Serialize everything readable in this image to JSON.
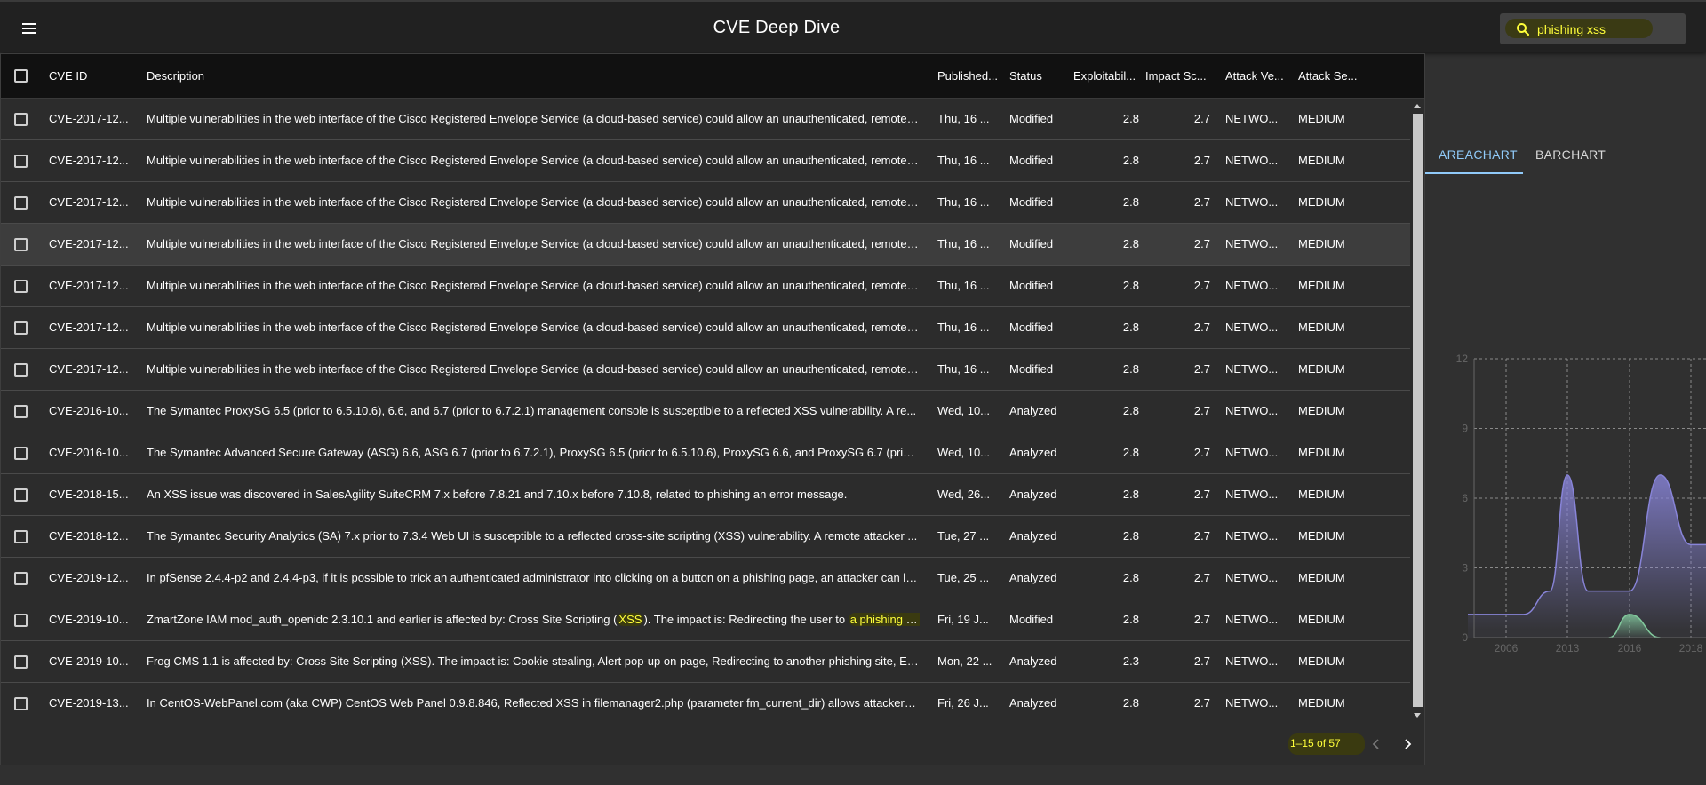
{
  "app": {
    "title": "CVE Deep Dive",
    "search_value": "phishing xss",
    "accent_color": "#90caf9",
    "highlight_color": "#ffff3a"
  },
  "table": {
    "columns": [
      "CVE ID",
      "Description",
      "Published...",
      "Status",
      "Exploitabil...",
      "Impact Sc...",
      "Attack Ve...",
      "Attack Se..."
    ],
    "rows": [
      {
        "id": "CVE-2017-12...",
        "desc": "Multiple vulnerabilities in the web interface of the Cisco Registered Envelope Service (a cloud-based service) could allow an unauthenticated, remote ...",
        "published": "Thu, 16 ...",
        "status": "Modified",
        "exploitability": "2.8",
        "impact": "2.7",
        "vector": "NETWO...",
        "severity": "MEDIUM"
      },
      {
        "id": "CVE-2017-12...",
        "desc": "Multiple vulnerabilities in the web interface of the Cisco Registered Envelope Service (a cloud-based service) could allow an unauthenticated, remote ...",
        "published": "Thu, 16 ...",
        "status": "Modified",
        "exploitability": "2.8",
        "impact": "2.7",
        "vector": "NETWO...",
        "severity": "MEDIUM"
      },
      {
        "id": "CVE-2017-12...",
        "desc": "Multiple vulnerabilities in the web interface of the Cisco Registered Envelope Service (a cloud-based service) could allow an unauthenticated, remote ...",
        "published": "Thu, 16 ...",
        "status": "Modified",
        "exploitability": "2.8",
        "impact": "2.7",
        "vector": "NETWO...",
        "severity": "MEDIUM"
      },
      {
        "id": "CVE-2017-12...",
        "desc": "Multiple vulnerabilities in the web interface of the Cisco Registered Envelope Service (a cloud-based service) could allow an unauthenticated, remote ...",
        "published": "Thu, 16 ...",
        "status": "Modified",
        "exploitability": "2.8",
        "impact": "2.7",
        "vector": "NETWO...",
        "severity": "MEDIUM"
      },
      {
        "id": "CVE-2017-12...",
        "desc": "Multiple vulnerabilities in the web interface of the Cisco Registered Envelope Service (a cloud-based service) could allow an unauthenticated, remote ...",
        "published": "Thu, 16 ...",
        "status": "Modified",
        "exploitability": "2.8",
        "impact": "2.7",
        "vector": "NETWO...",
        "severity": "MEDIUM"
      },
      {
        "id": "CVE-2017-12...",
        "desc": "Multiple vulnerabilities in the web interface of the Cisco Registered Envelope Service (a cloud-based service) could allow an unauthenticated, remote ...",
        "published": "Thu, 16 ...",
        "status": "Modified",
        "exploitability": "2.8",
        "impact": "2.7",
        "vector": "NETWO...",
        "severity": "MEDIUM"
      },
      {
        "id": "CVE-2017-12...",
        "desc": "Multiple vulnerabilities in the web interface of the Cisco Registered Envelope Service (a cloud-based service) could allow an unauthenticated, remote ...",
        "published": "Thu, 16 ...",
        "status": "Modified",
        "exploitability": "2.8",
        "impact": "2.7",
        "vector": "NETWO...",
        "severity": "MEDIUM"
      },
      {
        "id": "CVE-2016-10...",
        "desc": "The Symantec ProxySG 6.5 (prior to 6.5.10.6), 6.6, and 6.7 (prior to 6.7.2.1) management console is susceptible to a reflected XSS vulnerability. A re...",
        "published": "Wed, 10...",
        "status": "Analyzed",
        "exploitability": "2.8",
        "impact": "2.7",
        "vector": "NETWO...",
        "severity": "MEDIUM"
      },
      {
        "id": "CVE-2016-10...",
        "desc": "The Symantec Advanced Secure Gateway (ASG) 6.6, ASG 6.7 (prior to 6.7.2.1), ProxySG 6.5 (prior to 6.5.10.6), ProxySG 6.6, and ProxySG 6.7 (prior ...",
        "published": "Wed, 10...",
        "status": "Analyzed",
        "exploitability": "2.8",
        "impact": "2.7",
        "vector": "NETWO...",
        "severity": "MEDIUM"
      },
      {
        "id": "CVE-2018-15...",
        "desc": "An XSS issue was discovered in SalesAgility SuiteCRM 7.x before 7.8.21 and 7.10.x before 7.10.8, related to phishing an error message.",
        "published": "Wed, 26...",
        "status": "Analyzed",
        "exploitability": "2.8",
        "impact": "2.7",
        "vector": "NETWO...",
        "severity": "MEDIUM"
      },
      {
        "id": "CVE-2018-12...",
        "desc": "The Symantec Security Analytics (SA) 7.x prior to 7.3.4 Web UI is susceptible to a reflected cross-site scripting (XSS) vulnerability. A remote attacker ...",
        "published": "Tue, 27 ...",
        "status": "Analyzed",
        "exploitability": "2.8",
        "impact": "2.7",
        "vector": "NETWO...",
        "severity": "MEDIUM"
      },
      {
        "id": "CVE-2019-12...",
        "desc": "In pfSense 2.4.4-p2 and 2.4.4-p3, if it is possible to trick an authenticated administrator into clicking on a button on a phishing page, an attacker can le...",
        "published": "Tue, 25 ...",
        "status": "Analyzed",
        "exploitability": "2.8",
        "impact": "2.7",
        "vector": "NETWO...",
        "severity": "MEDIUM"
      },
      {
        "id": "CVE-2019-10...",
        "desc_parts": [
          "ZmartZone IAM mod_auth_openidc 2.3.10.1 and earlier is affected by: Cross Site Scripting (",
          "XSS",
          "). The impact is: Redirecting the user to ",
          "a phishing pa..."
        ],
        "published": "Fri, 19 J...",
        "status": "Modified",
        "exploitability": "2.8",
        "impact": "2.7",
        "vector": "NETWO...",
        "severity": "MEDIUM"
      },
      {
        "id": "CVE-2019-10...",
        "desc": "Frog CMS 1.1 is affected by: Cross Site Scripting (XSS). The impact is: Cookie stealing, Alert pop-up on page, Redirecting to another phishing site, Ex...",
        "published": "Mon, 22 ...",
        "status": "Analyzed",
        "exploitability": "2.3",
        "impact": "2.7",
        "vector": "NETWO...",
        "severity": "MEDIUM"
      },
      {
        "id": "CVE-2019-13...",
        "desc": "In CentOS-WebPanel.com (aka CWP) CentOS Web Panel 0.9.8.846, Reflected XSS in filemanager2.php (parameter fm_current_dir) allows attackers t...",
        "published": "Fri, 26 J...",
        "status": "Analyzed",
        "exploitability": "2.8",
        "impact": "2.7",
        "vector": "NETWO...",
        "severity": "MEDIUM"
      }
    ],
    "pagination": "1–15 of 57"
  },
  "chart_tabs": [
    "AREACHART",
    "BARCHART"
  ],
  "chart_data": {
    "type": "area",
    "x_ticks": [
      "2006",
      "2013",
      "2016",
      "2018"
    ],
    "ylim": [
      0,
      12
    ],
    "y_ticks": [
      "0",
      "3",
      "6",
      "9",
      "12"
    ],
    "grid": true,
    "series": [
      {
        "color": "#8884d8",
        "points": [
          [
            2003,
            1
          ],
          [
            2008,
            1
          ],
          [
            2011,
            2
          ],
          [
            2013,
            7
          ],
          [
            2014,
            2
          ],
          [
            2016,
            2
          ],
          [
            2017,
            7
          ],
          [
            2018,
            4
          ],
          [
            2019,
            4
          ]
        ]
      },
      {
        "color": "#82ca9d",
        "points": [
          [
            2015,
            0
          ],
          [
            2016,
            1
          ],
          [
            2017,
            0
          ]
        ]
      }
    ]
  }
}
